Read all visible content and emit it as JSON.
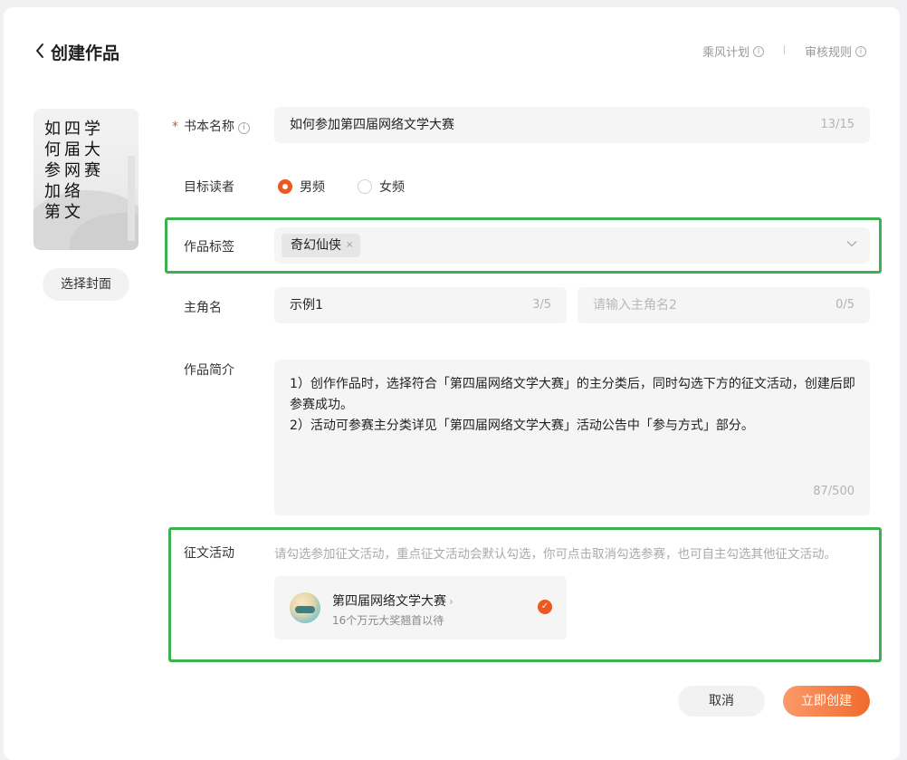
{
  "header": {
    "back_icon": "chevron-left-icon",
    "title": "创建作品",
    "links": [
      {
        "label": "乘风计划",
        "icon": "info-icon"
      },
      {
        "label": "审核规则",
        "icon": "info-icon"
      }
    ]
  },
  "cover": {
    "title_columns": [
      [
        "如",
        "何",
        "参",
        "加",
        "第"
      ],
      [
        "四",
        "届",
        "网",
        "络",
        "文"
      ],
      [
        "学",
        "大",
        "赛"
      ]
    ],
    "select_button": "选择封面"
  },
  "form": {
    "book_name": {
      "label": "书本名称",
      "required_mark": "*",
      "help_icon": "question-icon",
      "value": "如何参加第四届网络文学大赛",
      "counter": "13/15"
    },
    "target_readers": {
      "label": "目标读者",
      "options": [
        "男频",
        "女频"
      ],
      "selected": "男频"
    },
    "tags": {
      "label": "作品标签",
      "values": [
        "奇幻仙侠"
      ],
      "remove_glyph": "×"
    },
    "protagonist": {
      "label": "主角名",
      "value1": "示例1",
      "counter1": "3/5",
      "placeholder2": "请输入主角名2",
      "counter2": "0/5"
    },
    "description": {
      "label": "作品简介",
      "lines": [
        "1）创作作品时，选择符合「第四届网络文学大赛」的主分类后，同时勾选下方的征文活动，创建后即参赛成功。",
        "2）活动可参赛主分类详见「第四届网络文学大赛」活动公告中「参与方式」部分。"
      ],
      "counter": "87/500"
    },
    "event": {
      "label": "征文活动",
      "tip": "请勾选参加征文活动，重点征文活动会默认勾选，你可点击取消勾选参赛，也可自主勾选其他征文活动。",
      "card": {
        "name": "第四届网络文学大赛",
        "arrow": "›",
        "sub": "16个万元大奖翘首以待",
        "checked": true
      }
    }
  },
  "actions": {
    "cancel": "取消",
    "create": "立即创建"
  },
  "colors": {
    "accent": "#f0561f",
    "highlight": "#3fb04f"
  }
}
